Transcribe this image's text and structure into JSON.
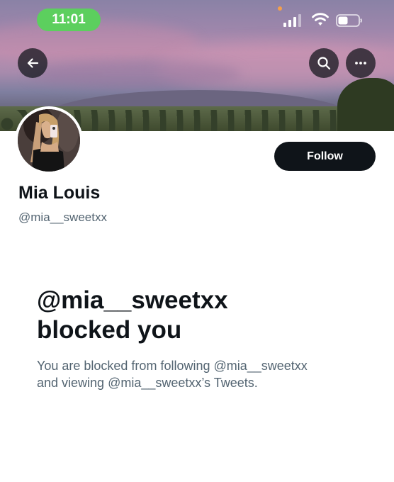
{
  "status_bar": {
    "time": "11:01",
    "icons": [
      "signal-icon",
      "wifi-icon",
      "battery-icon"
    ]
  },
  "header": {
    "buttons": [
      "back-icon",
      "search-icon",
      "more-icon"
    ]
  },
  "profile": {
    "display_name": "Mia Louis",
    "handle": "@mia__sweetxx",
    "follow_label": "Follow"
  },
  "blocked": {
    "title_line1": "@mia__sweetxx",
    "title_line2": "blocked you",
    "description_line1": "You are blocked from following @mia__sweetxx",
    "description_line2": "and viewing @mia__sweetxx’s Tweets."
  },
  "colors": {
    "accent_dark": "#0f1419",
    "secondary_text": "#536471",
    "time_pill": "#5ccf5e"
  }
}
